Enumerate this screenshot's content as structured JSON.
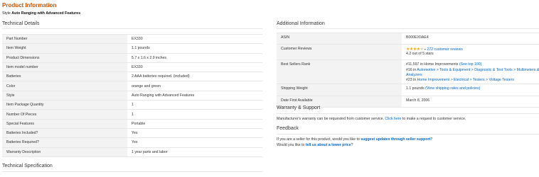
{
  "page_title": "Product Information",
  "style_line": {
    "label": "Style",
    "value": "Auto Ranging with Advanced Features"
  },
  "technical_details": {
    "title": "Technical Details",
    "rows": [
      {
        "k": "Part Number",
        "v": "EX330"
      },
      {
        "k": "Item Weight",
        "v": "1.1 pounds"
      },
      {
        "k": "Product Dimensions",
        "v": "5.7 x 1.6 x 2.9 inches"
      },
      {
        "k": "Item model number",
        "v": "EX330"
      },
      {
        "k": "Batteries",
        "v": "2 AAA batteries required. (included)"
      },
      {
        "k": "Color",
        "v": "orange and green"
      },
      {
        "k": "Style",
        "v": "Auto Ranging with Advanced Features"
      },
      {
        "k": "Item Package Quantity",
        "v": "1"
      },
      {
        "k": "Number Of Pieces",
        "v": "1"
      },
      {
        "k": "Special Features",
        "v": "Portable"
      },
      {
        "k": "Batteries Included?",
        "v": "Yes"
      },
      {
        "k": "Batteries Required?",
        "v": "Yes"
      },
      {
        "k": "Warranty Description",
        "v": "1 year parts and labor"
      }
    ]
  },
  "technical_specification": {
    "title": "Technical Specification"
  },
  "additional_information": {
    "title": "Additional Information",
    "asin_label": "ASIN",
    "asin": "B000EX0AE4",
    "reviews_label": "Customer Reviews",
    "stars_on": "★★★★",
    "stars_off": "★",
    "caret": "▾",
    "reviews_link": "272 customer reviews",
    "rating_text": "4.2 out of 5 stars",
    "bsr_label": "Best Sellers Rank",
    "bsr_main_rank": "#11,597 in Home Improvements",
    "bsr_main_link": "(See top 100)",
    "bsr_2_rank": "#16 in",
    "bsr_2_path": "Automotive > Tools & Equipment > Diagnostic & Test Tools > Multimeters & Analyzers",
    "bsr_3_rank": "#23 in",
    "bsr_3_path": "Home Improvement > Electrical > Testers > Voltage Testers",
    "shipping_label": "Shipping Weight",
    "shipping_value": "1.1 pounds",
    "shipping_link": "(View shipping rates and policies)",
    "date_label": "Date First Available",
    "date_value": "March 8, 2006"
  },
  "warranty": {
    "title": "Warranty & Support",
    "text_before": "Manufacturer's warranty can be requested from customer service.",
    "link": "Click here",
    "text_after": "to make a request to customer service."
  },
  "feedback": {
    "title": "Feedback",
    "line1_before": "If you are a seller for this product, would you like to",
    "line1_link": "suggest updates through seller support",
    "line1_after": "?",
    "line2_before": "Would you like to",
    "line2_link": "tell us about a lower price",
    "line2_after": "?"
  }
}
